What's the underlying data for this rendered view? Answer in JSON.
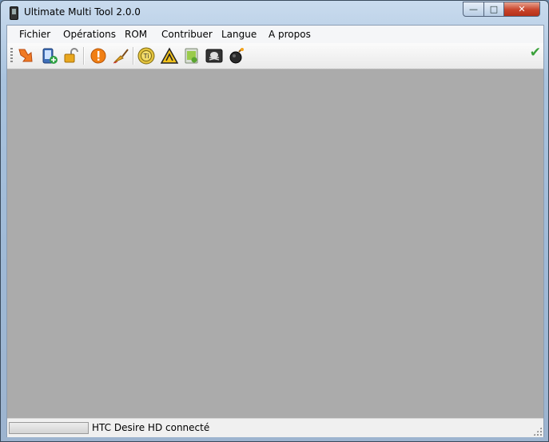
{
  "window": {
    "title": "Ultimate Multi Tool 2.0.0",
    "controls": {
      "minimize": "—",
      "maximize": "□",
      "close": "✕"
    }
  },
  "menu": [
    "Fichier",
    "Opérations",
    "ROM",
    "Contribuer",
    "Langue",
    "A propos"
  ],
  "toolbar": {
    "icons": [
      "flash-arrow-icon",
      "phone-add-icon",
      "unlock-icon",
      "warning-circle-icon",
      "cleaner-brush-icon",
      "titanium-backup-icon",
      "hazard-triangle-icon",
      "android-apk-icon",
      "pirate-terminal-icon",
      "bomb-icon"
    ],
    "status_check": "✔"
  },
  "status": {
    "text": "HTC Desire HD connecté",
    "progress": 0
  },
  "colors": {
    "content_bg": "#ababab",
    "check_green": "#3aa13a",
    "close_red": "#c8432a"
  }
}
